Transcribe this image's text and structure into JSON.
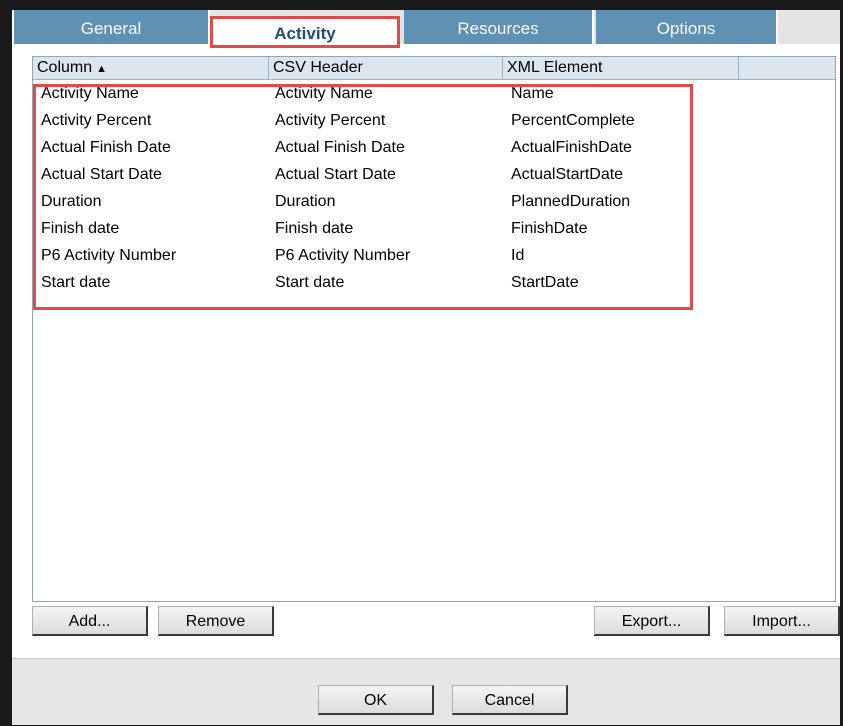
{
  "tabs": [
    {
      "label": "General"
    },
    {
      "label": "Activity"
    },
    {
      "label": "Resources"
    },
    {
      "label": "Options"
    }
  ],
  "active_tab": "Activity",
  "table": {
    "headers": {
      "column": "Column",
      "csv": "CSV Header",
      "xml": "XML Element"
    },
    "sort_indicator": "▲",
    "rows": [
      {
        "column": "Activity Name",
        "csv": "Activity Name",
        "xml": "Name"
      },
      {
        "column": "Activity Percent",
        "csv": "Activity Percent",
        "xml": "PercentComplete"
      },
      {
        "column": "Actual Finish Date",
        "csv": "Actual Finish Date",
        "xml": "ActualFinishDate"
      },
      {
        "column": "Actual Start Date",
        "csv": "Actual Start Date",
        "xml": "ActualStartDate"
      },
      {
        "column": "Duration",
        "csv": "Duration",
        "xml": "PlannedDuration"
      },
      {
        "column": "Finish date",
        "csv": "Finish date",
        "xml": "FinishDate"
      },
      {
        "column": "P6 Activity Number",
        "csv": "P6 Activity Number",
        "xml": "Id"
      },
      {
        "column": "Start date",
        "csv": "Start date",
        "xml": "StartDate"
      }
    ]
  },
  "buttons": {
    "add": "Add...",
    "remove": "Remove",
    "export": "Export...",
    "import": "Import...",
    "ok": "OK",
    "cancel": "Cancel"
  },
  "colors": {
    "tab_blue": "#5e91b3",
    "highlight_red": "#e24a4a",
    "header_bg": "#dce6ef"
  }
}
